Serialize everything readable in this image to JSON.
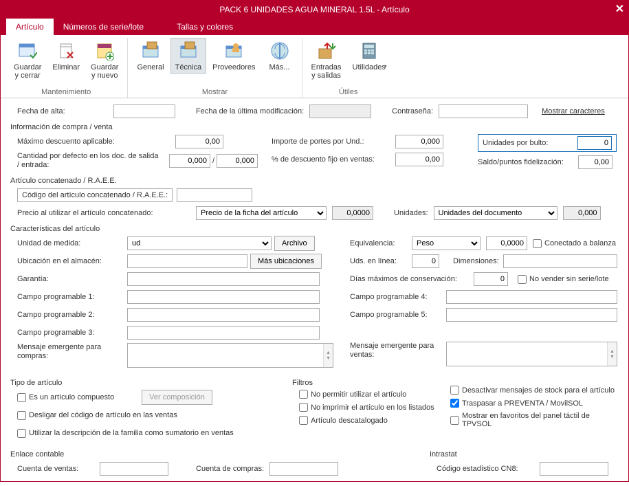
{
  "window": {
    "title": "PACK 6 UNIDADES AGUA MINERAL 1.5L - Artículo"
  },
  "tabs": {
    "articulo": "Artículo",
    "series": "Números de serie/lote",
    "tallas": "Tallas y colores"
  },
  "ribbon": {
    "guardar_cerrar": "Guardar\ny cerrar",
    "eliminar": "Eliminar",
    "guardar_nuevo": "Guardar\ny nuevo",
    "general": "General",
    "tecnica": "Técnica",
    "proveedores": "Proveedores",
    "mas": "Más...",
    "entradas": "Entradas\ny salidas",
    "utilidades": "Utilidades",
    "mantenimiento": "Mantenimiento",
    "mostrar": "Mostrar",
    "utiles": "Útiles"
  },
  "top": {
    "fecha_alta_lbl": "Fecha de alta:",
    "fecha_alta": "",
    "fecha_mod_lbl": "Fecha de la última modificación:",
    "fecha_mod": "",
    "contrasena_lbl": "Contraseña:",
    "contrasena": "",
    "mostrar_caracteres": "Mostrar caracteres"
  },
  "compra": {
    "title": "Información de compra / venta",
    "max_desc_lbl": "Máximo descuento aplicable:",
    "max_desc": "0,00",
    "cant_defecto_lbl": "Cantidad por defecto en los doc. de salida / entrada:",
    "cant_salida": "0,000",
    "cant_entrada": "0,000",
    "importe_portes_lbl": "Importe de portes por Und.:",
    "importe_portes": "0,000",
    "desc_fijo_lbl": "% de descuento fijo en ventas:",
    "desc_fijo": "0,00",
    "unidades_bulto_lbl": "Unidades por bulto:",
    "unidades_bulto": "0",
    "saldo_lbl": "Saldo/puntos fidelización:",
    "saldo": "0,00"
  },
  "concat": {
    "title": "Artículo concatenado / R.A.E.E.",
    "codigo_lbl": "Código del artículo concatenado / R.A.E.E.:",
    "codigo": "",
    "precio_lbl": "Precio al utilizar el artículo concatenado:",
    "precio_sel": "Precio de la ficha del artículo",
    "precio_val": "0,0000",
    "unidades_lbl": "Unidades:",
    "unidades_sel": "Unidades del documento",
    "unidades_val": "0,000"
  },
  "carac": {
    "title": "Características del artículo",
    "unidad_lbl": "Unidad de medida:",
    "unidad_sel": "ud",
    "archivo_btn": "Archivo",
    "ubicacion_lbl": "Ubicación en el almacén:",
    "ubicacion": "",
    "mas_ubic_btn": "Más ubicaciones",
    "garantia_lbl": "Garantía:",
    "garantia": "",
    "cp1_lbl": "Campo programable 1:",
    "cp1": "",
    "cp2_lbl": "Campo programable 2:",
    "cp2": "",
    "cp3_lbl": "Campo programable 3:",
    "cp3": "",
    "equiv_lbl": "Equivalencia:",
    "equiv_sel": "Peso",
    "equiv_val": "0,0000",
    "conectado_lbl": "Conectado a balanza",
    "uds_linea_lbl": "Uds. en línea:",
    "uds_linea": "0",
    "dimensiones_lbl": "Dimensiones:",
    "dimensiones": "",
    "dias_lbl": "Días máximos de conservación:",
    "dias": "0",
    "no_vender_lbl": "No vender sin serie/lote",
    "cp4_lbl": "Campo programable 4:",
    "cp4": "",
    "cp5_lbl": "Campo programable 5:",
    "cp5": "",
    "msg_compras_lbl": "Mensaje emergente para compras:",
    "msg_ventas_lbl": "Mensaje emergente para ventas:"
  },
  "tipo": {
    "title": "Tipo de artículo",
    "compuesto": "Es un artículo compuesto",
    "ver_comp_btn": "Ver composición",
    "desligar": "Desligar del código de artículo en las ventas",
    "desc_familia": "Utilizar la descripción de la familia como sumatorio en ventas"
  },
  "filtros": {
    "title": "Filtros",
    "no_permitir": "No permitir utilizar el artículo",
    "no_imprimir": "No imprimir el artículo en los listados",
    "descatalogado": "Artículo descatalogado",
    "desactivar_stock": "Desactivar mensajes de stock para el artículo",
    "traspasar": "Traspasar a PREVENTA / MovilSOL",
    "favoritos": "Mostrar en favoritos del panel táctil de TPVSOL"
  },
  "enlace": {
    "title": "Enlace contable",
    "cuenta_ventas_lbl": "Cuenta de ventas:",
    "cuenta_ventas": "",
    "cuenta_compras_lbl": "Cuenta de compras:",
    "cuenta_compras": ""
  },
  "intrastat": {
    "title": "Intrastat",
    "cn8_lbl": "Código estadístico CN8:",
    "cn8": ""
  }
}
